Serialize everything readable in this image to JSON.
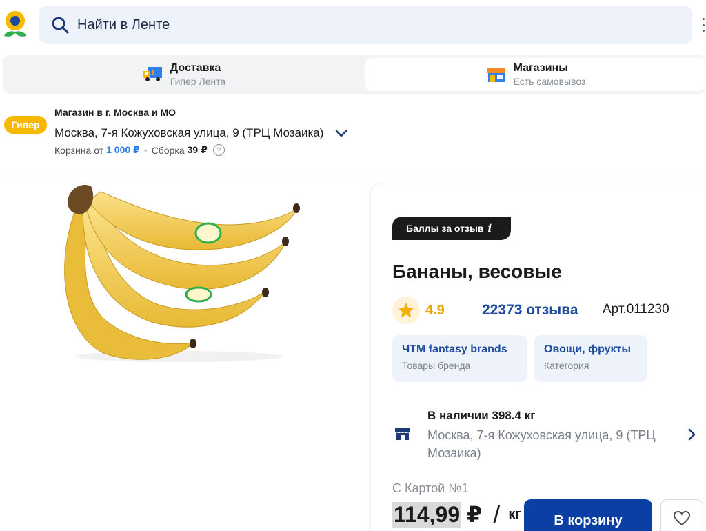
{
  "header": {
    "logo_icon": "sunflower-logo-icon",
    "search_placeholder": "Найти в Ленте",
    "search_icon": "search-icon",
    "menu_icon": "kebab-menu-icon"
  },
  "delivery_switch": {
    "delivery": {
      "title": "Доставка",
      "subtitle": "Гипер Лента",
      "icon": "delivery-truck-icon"
    },
    "stores": {
      "title": "Магазины",
      "subtitle": "Есть самовывоз",
      "icon": "store-icon",
      "selected": true
    }
  },
  "store": {
    "format_badge": "Гипер",
    "region_title": "Магазин в г. Москва и МО",
    "address": "Москва, 7-я Кожуховская улица, 9 (ТРЦ Мозаика)",
    "cart_min_label": "Корзина от",
    "cart_min_value": "1 000 ₽",
    "assembly_label": "Сборка",
    "assembly_value": "39 ₽",
    "help_icon": "question-icon"
  },
  "product": {
    "image_alt": "banana-bunch-image",
    "points_badge": "Баллы за отзыв",
    "points_badge_info": "i",
    "title": "Бананы, весовые",
    "rating": "4.9",
    "reviews": "22373 отзыва",
    "article": "Арт.011230",
    "chips": [
      {
        "title": "ЧТМ fantasy brands",
        "subtitle": "Товары бренда"
      },
      {
        "title": "Овощи, фрукты",
        "subtitle": "Категория"
      }
    ],
    "availability": {
      "title": "В наличии 398.4 кг",
      "address": "Москва, 7-я Кожуховская улица, 9 (ТРЦ Мозаика)"
    },
    "price_label": "С Картой №1",
    "price": "114,99",
    "currency": "₽",
    "slash": "/",
    "unit": "кг",
    "cart_button": "В корзину"
  },
  "colors": {
    "brand_blue": "#0b3fa3",
    "link_blue": "#1d4a9c",
    "accent_yellow": "#f9b800",
    "rating_orange": "#e8a700"
  }
}
